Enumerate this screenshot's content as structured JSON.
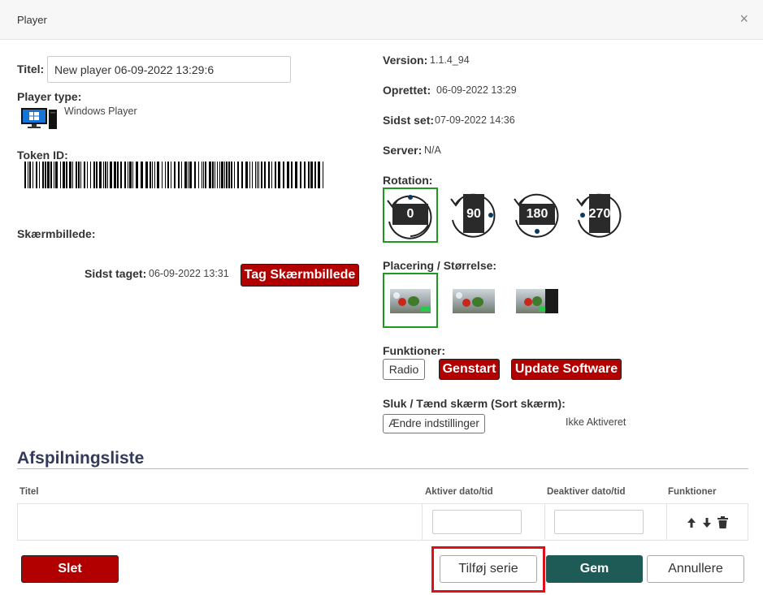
{
  "header": {
    "title": "Player",
    "close_glyph": "×"
  },
  "left": {
    "titel_label": "Titel:",
    "titel_value": "New player 06-09-2022 13:29:6",
    "player_type_label": "Player type:",
    "player_type_value": "Windows Player",
    "token_label": "Token ID:",
    "screenshot_label": "Skærmbillede:",
    "last_taken_label": "Sidst taget:",
    "last_taken_value": "06-09-2022 13:31",
    "take_screenshot_button": "Tag Skærmbillede"
  },
  "right": {
    "version_label": "Version:",
    "version_value": "1.1.4_94",
    "created_label": "Oprettet:",
    "created_value": "06-09-2022 13:29",
    "last_seen_label": "Sidst set:",
    "last_seen_value": "07-09-2022 14:36",
    "server_label": "Server:",
    "server_value": "N/A",
    "rotation_label": "Rotation:",
    "rotations": [
      "0",
      "90",
      "180",
      "270"
    ],
    "rotation_selected": "0",
    "placement_label": "Placering / Størrelse:",
    "placement_selected": 0,
    "functions_label": "Funktioner:",
    "radio_button": "Radio",
    "restart_button": "Genstart",
    "update_button": "Update Software",
    "screen_label": "Sluk / Tænd skærm (Sort skærm):",
    "change_settings_button": "Ændre indstillinger",
    "screen_status": "Ikke Aktiveret"
  },
  "playlist": {
    "title": "Afspilningsliste",
    "columns": [
      "Titel",
      "Aktiver dato/tid",
      "Deaktiver dato/tid",
      "Funktioner"
    ],
    "activate_value": "",
    "deactivate_value": ""
  },
  "footer": {
    "delete_button": "Slet",
    "add_series_button": "Tilføj serie",
    "save_button": "Gem",
    "cancel_button": "Annullere"
  },
  "colors": {
    "danger": "#b20000",
    "primary": "#1e5b57",
    "selected_border": "#1d9a1d",
    "highlight": "#e0101a",
    "section_title": "#333a5a"
  },
  "icons": [
    "close-icon",
    "windows-pc-icon",
    "barcode-icon",
    "rotate-icon",
    "arrow-up-icon",
    "arrow-down-icon",
    "trash-icon"
  ]
}
